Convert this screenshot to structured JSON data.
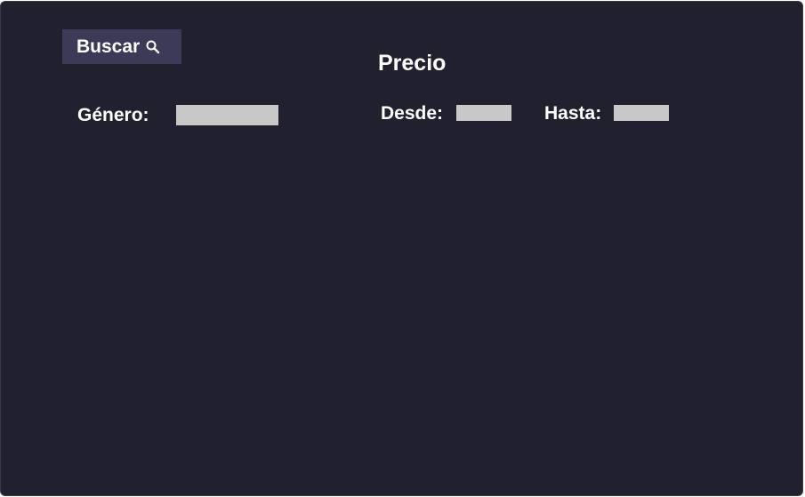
{
  "search": {
    "button_label": "Buscar",
    "icon": "search-icon"
  },
  "price": {
    "heading": "Precio",
    "from_label": "Desde:",
    "from_value": "",
    "to_label": "Hasta:",
    "to_value": ""
  },
  "genre": {
    "label": "Género:",
    "value": ""
  },
  "colors": {
    "background": "#21202e",
    "button": "#3c3a56",
    "field": "#c8c8c8",
    "text": "#ffffff"
  }
}
